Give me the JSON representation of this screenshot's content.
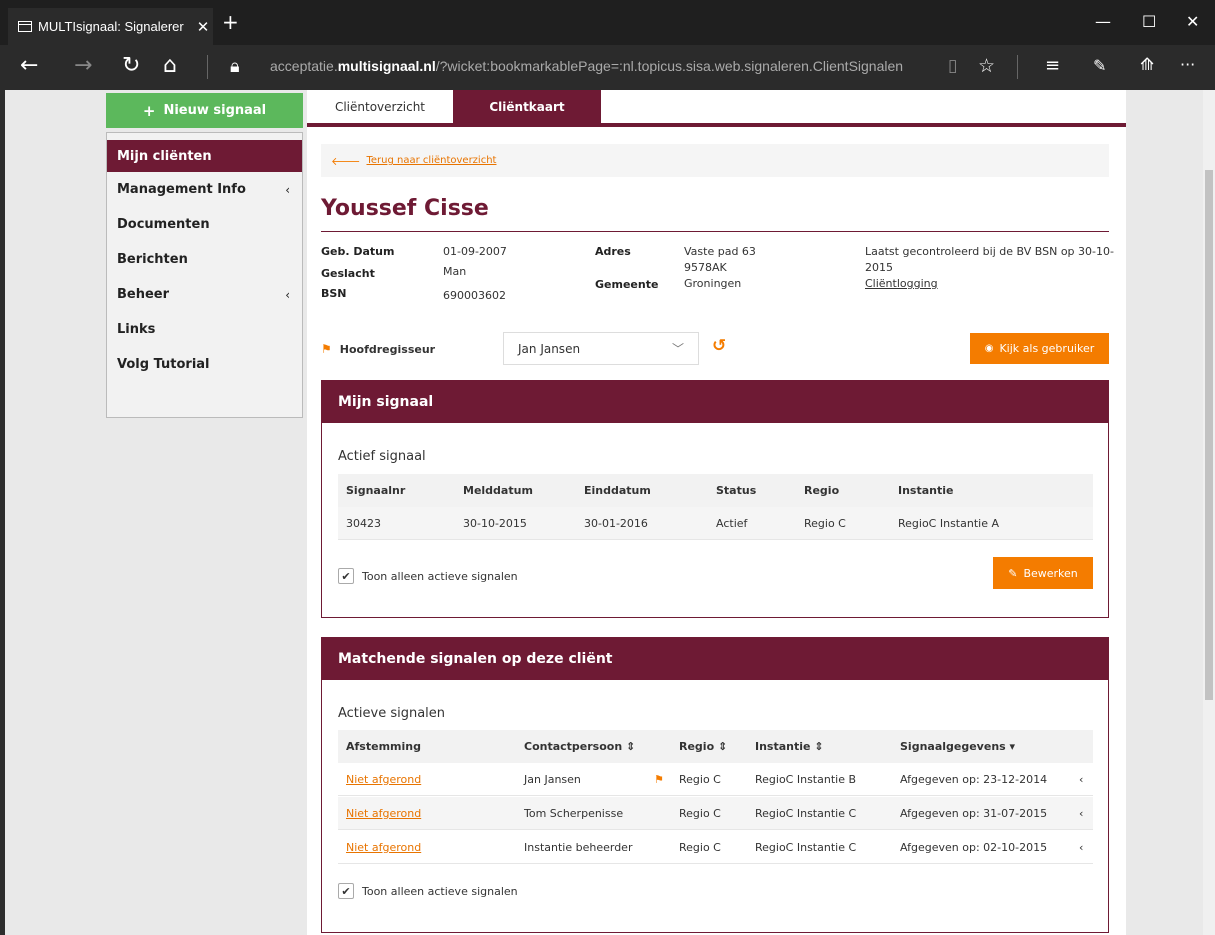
{
  "browser": {
    "tab_title": "MULTIsignaal: Signalerer",
    "tab_close": "✕",
    "new_tab": "+",
    "url_prefix": "acceptatie.",
    "url_domain": "multisignaal.nl",
    "url_rest": "/?wicket:bookmarkablePage=:nl.topicus.sisa.web.signaleren.ClientSignalen",
    "icons": [
      "window-icon",
      "back-icon",
      "forward-icon",
      "refresh-icon",
      "home-icon",
      "lock-icon",
      "reading-view-icon",
      "favorite-star-icon",
      "hub-icon",
      "web-note-icon",
      "share-icon",
      "more-icon",
      "minimize-icon",
      "maximize-icon",
      "close-icon"
    ]
  },
  "sidebar": {
    "new_button": "Nieuw signaal",
    "items": [
      {
        "label": "Mijn cliënten",
        "chevron": ""
      },
      {
        "label": "Management Info",
        "chevron": "‹"
      },
      {
        "label": "Documenten",
        "chevron": ""
      },
      {
        "label": "Berichten",
        "chevron": ""
      },
      {
        "label": "Beheer",
        "chevron": "‹"
      },
      {
        "label": "Links",
        "chevron": ""
      },
      {
        "label": "Volg Tutorial",
        "chevron": ""
      }
    ]
  },
  "tabs": {
    "overview": "Cliëntoverzicht",
    "card": "Cliëntkaart"
  },
  "back_link": "Terug naar cliëntoverzicht",
  "client": {
    "name": "Youssef Cisse",
    "geb_label": "Geb. Datum",
    "geb_value": "01-09-2007",
    "geslacht_label": "Geslacht",
    "geslacht_value": "Man",
    "bsn_label": "BSN",
    "bsn_value": "690003602",
    "adres_label": "Adres",
    "adres_line1": "Vaste pad 63",
    "adres_line2": "9578AK",
    "gemeente_label": "Gemeente",
    "gemeente_value": "Groningen",
    "bsn_check_line1": "Laatst gecontroleerd bij de BV BSN op 30-10-",
    "bsn_check_line2": "2015",
    "logging_link": "Cliëntlogging"
  },
  "regisseur": {
    "label": "Hoofdregisseur",
    "selected": "Jan Jansen",
    "kijk_button": "Kijk als gebruiker"
  },
  "mijn_signaal": {
    "title": "Mijn signaal",
    "subtitle": "Actief signaal",
    "columns": [
      "Signaalnr",
      "Melddatum",
      "Einddatum",
      "Status",
      "Regio",
      "Instantie"
    ],
    "rows": [
      [
        "30423",
        "30-10-2015",
        "30-01-2016",
        "Actief",
        "Regio C",
        "RegioC Instantie A"
      ]
    ],
    "checkbox_label": "Toon alleen actieve signalen",
    "edit_button": "Bewerken"
  },
  "matchende": {
    "title": "Matchende signalen op deze cliënt",
    "subtitle": "Actieve signalen",
    "columns": [
      "Afstemming",
      "Contactpersoon ⇕",
      "Regio ⇕",
      "Instantie ⇕",
      "Signaalgegevens ▾"
    ],
    "rows": [
      {
        "afstemming": "Niet afgerond",
        "contact": "Jan Jansen",
        "flag": true,
        "regio": "Regio C",
        "instantie": "RegioC Instantie B",
        "gegevens": "Afgegeven op: 23-12-2014",
        "chev": "‹"
      },
      {
        "afstemming": "Niet afgerond",
        "contact": "Tom Scherpenisse",
        "flag": false,
        "regio": "Regio C",
        "instantie": "RegioC Instantie C",
        "gegevens": "Afgegeven op: 31-07-2015",
        "chev": "‹"
      },
      {
        "afstemming": "Niet afgerond",
        "contact": "Instantie beheerder",
        "flag": false,
        "regio": "Regio C",
        "instantie": "RegioC Instantie C",
        "gegevens": "Afgegeven op: 02-10-2015",
        "chev": "‹"
      }
    ],
    "checkbox_label": "Toon alleen actieve signalen"
  },
  "colors": {
    "brand": "#6e1a34",
    "accent": "#f47c00",
    "success": "#5cb85c"
  }
}
